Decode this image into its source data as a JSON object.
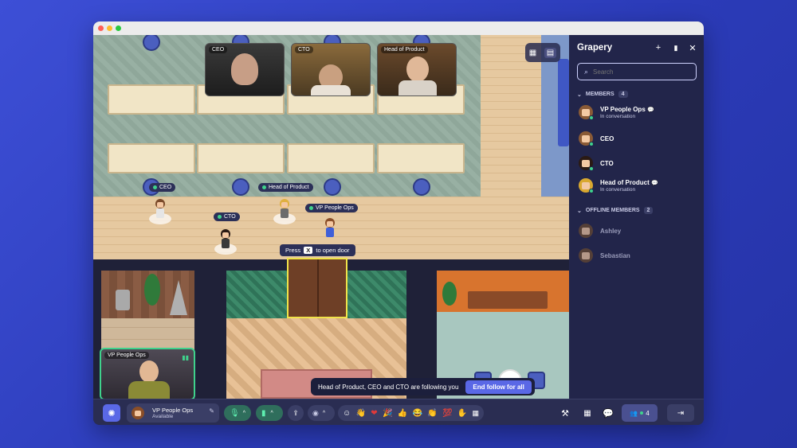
{
  "window": {
    "traffic_lights": [
      "#ff5f57",
      "#febc2e",
      "#28c840"
    ]
  },
  "map": {
    "video_tiles": [
      {
        "label": "CEO"
      },
      {
        "label": "CTO"
      },
      {
        "label": "Head of Product"
      }
    ],
    "name_tags": [
      "CEO",
      "Head of Product",
      "CTO",
      "VP People Ops"
    ],
    "door_hint": {
      "prefix": "Press",
      "key": "X",
      "suffix": "to open door"
    },
    "self_video_label": "VP People Ops",
    "follow_banner": {
      "text": "Head of Product, CEO and CTO are following you",
      "button": "End follow for all"
    },
    "view_toggle": [
      "grid-icon",
      "map-icon"
    ]
  },
  "panel": {
    "title": "Grapery",
    "search_placeholder": "Search",
    "members_label": "MEMBERS",
    "members_count": "4",
    "members": [
      {
        "name": "VP People Ops",
        "status": "In conversation",
        "chat": true
      },
      {
        "name": "CEO",
        "status": "",
        "chat": false
      },
      {
        "name": "CTO",
        "status": "",
        "chat": false
      },
      {
        "name": "Head of Product",
        "status": "In conversation",
        "chat": true
      }
    ],
    "offline_label": "OFFLINE MEMBERS",
    "offline_count": "2",
    "offline": [
      {
        "name": "Ashley"
      },
      {
        "name": "Sebastian"
      }
    ]
  },
  "bottombar": {
    "user_name": "VP People Ops",
    "user_status": "Available",
    "participants_count": "4",
    "reactions": [
      "☺",
      "👋",
      "❤",
      "🎉",
      "👍",
      "😂",
      "👏",
      "💯"
    ]
  },
  "colors": {
    "accent": "#5a68e6",
    "online": "#3fd28c",
    "panel_bg": "#22254a"
  }
}
